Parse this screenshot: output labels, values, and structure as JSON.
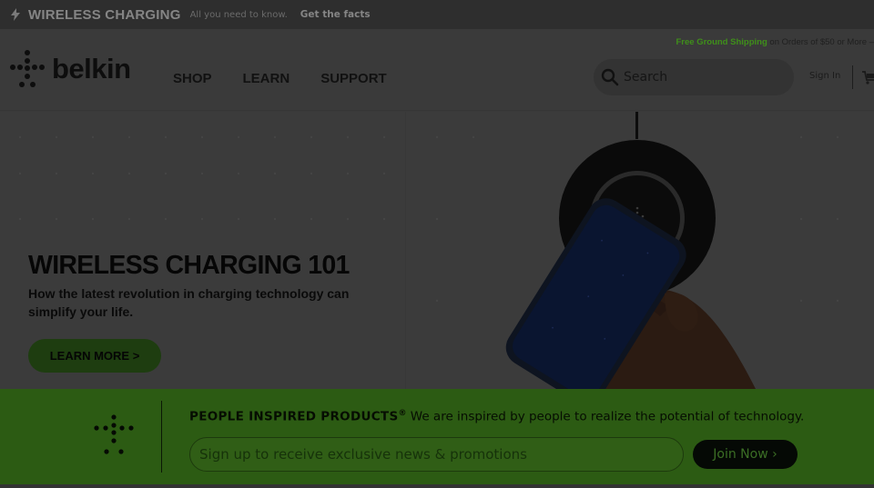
{
  "promo": {
    "title": "WIRELESS CHARGING",
    "subtitle": "All you need to know.",
    "link": "Get the facts"
  },
  "header": {
    "shipping_highlight": "Free Ground Shipping",
    "shipping_rest": "on Orders of $50 or More –",
    "logo_text": "belkin",
    "nav": [
      "SHOP",
      "LEARN",
      "SUPPORT"
    ],
    "search_placeholder": "Search",
    "sign_in": "Sign In"
  },
  "hero": {
    "title": "WIRELESS CHARGING 101",
    "subtitle": "How the latest revolution in charging technology can simplify your life.",
    "cta": "LEARN MORE >"
  },
  "newsletter": {
    "heading": "PEOPLE INSPIRED PRODUCTS",
    "registered": "®",
    "tagline": "We are inspired by people to realize the potential of technology.",
    "email_placeholder": "Sign up to receive exclusive news & promotions",
    "join": "Join Now ›"
  },
  "colors": {
    "accent_green": "#2c5b13",
    "shipping_green": "#3f8f1a",
    "overlay_dark": "#3a3a3a"
  },
  "icons": [
    "lightning-bolt-icon",
    "belkin-logo-mark",
    "search-icon",
    "cart-icon"
  ]
}
